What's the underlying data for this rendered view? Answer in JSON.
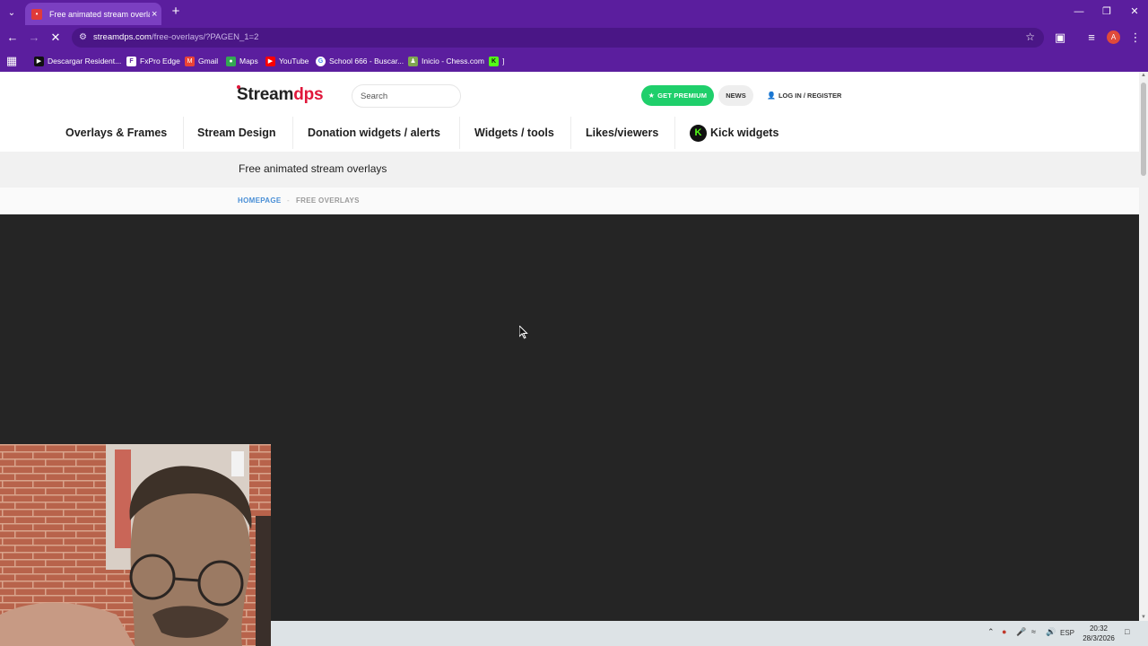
{
  "browser": {
    "tab_title": "Free animated stream overlays",
    "url_domain": "streamdps.com",
    "url_path": "/free-overlays/?PAGEN_1=2",
    "profile_initial": "A",
    "bookmarks": [
      "Descargar Resident...",
      "FxPro Edge",
      "Gmail",
      "Maps",
      "YouTube",
      "School 666 - Buscar...",
      "Inicio - Chess.com",
      "]"
    ]
  },
  "header": {
    "logo_main": "Stream",
    "logo_accent": "dps",
    "search_placeholder": "Search",
    "premium_label": "GET PREMIUM",
    "news_label": "NEWS",
    "login_label": "LOG IN / REGISTER"
  },
  "nav": {
    "items": [
      "Overlays & Frames",
      "Stream Design",
      "Donation widgets / alerts",
      "Widgets / tools",
      "Likes/viewers",
      "Kick widgets"
    ],
    "kick_badge": "K"
  },
  "page": {
    "title": "Free animated stream overlays",
    "breadcrumb_home": "HOMEPAGE",
    "breadcrumb_sep": "-",
    "breadcrumb_current": "FREE OVERLAYS"
  },
  "taskbar": {
    "language": "ESP",
    "time": "20:32",
    "date": "28/3/2026"
  },
  "colors": {
    "browser_purple": "#5b1e9e",
    "brand_red": "#e0173b",
    "premium_green": "#1fcf6b",
    "hero_dark": "#252525"
  }
}
